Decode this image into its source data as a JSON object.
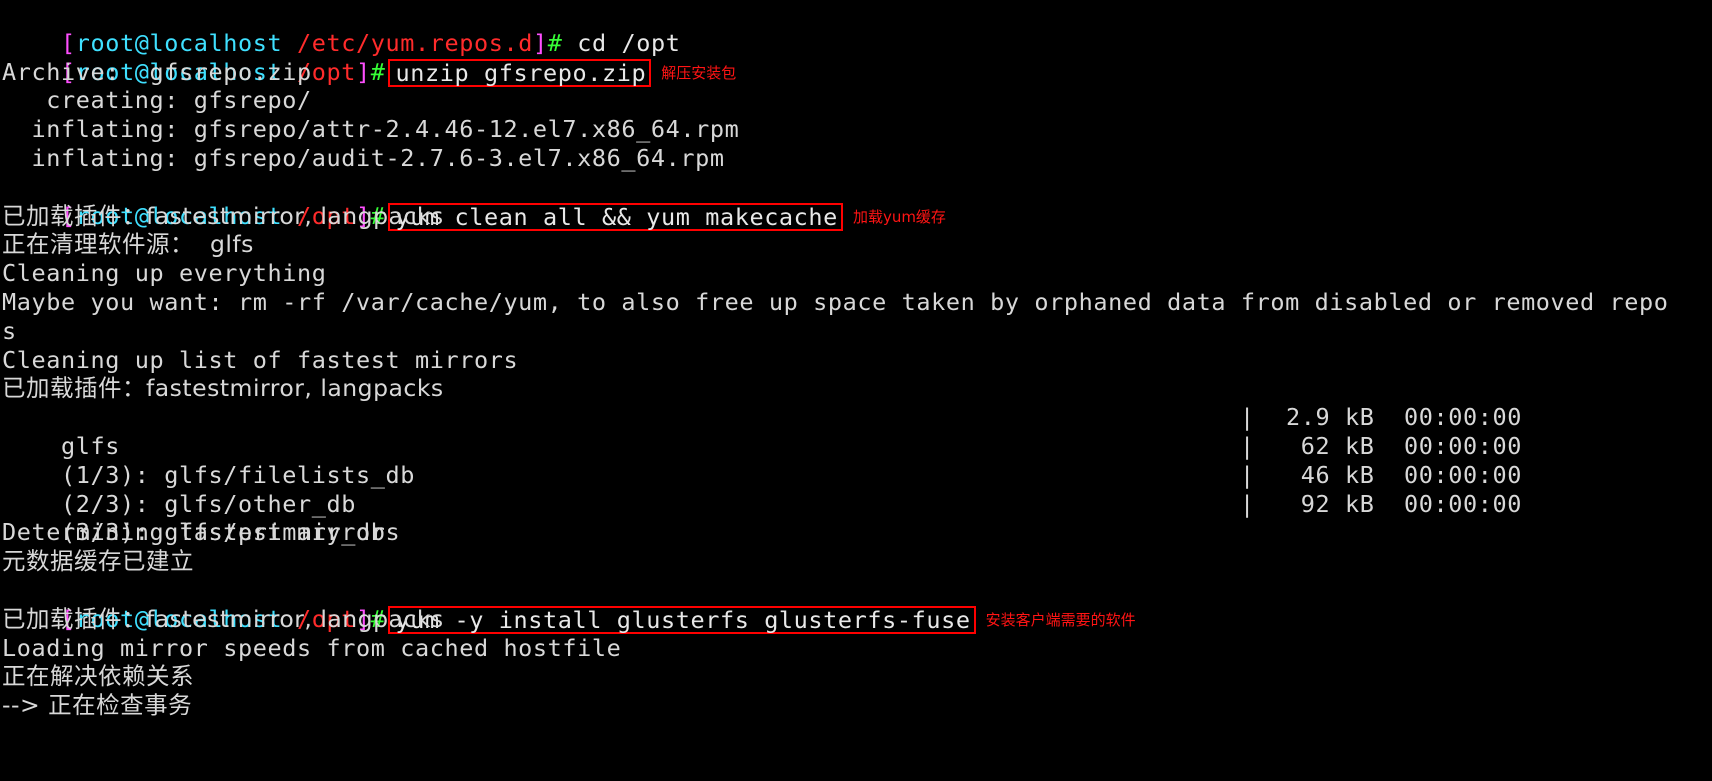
{
  "terminal": {
    "user": "root",
    "host": "localhost",
    "prompt_sep": "@",
    "hash": "#",
    "colors": {
      "background": "#000000",
      "foreground": "#d8d8d8",
      "bracket_magenta": "#ff4fff",
      "host_cyan": "#3fe0ff",
      "path_red": "#ff2b2b",
      "hash_green": "#36ff36",
      "annotation_red": "#ff1414",
      "box_border": "#ff0000"
    },
    "lines": [
      {
        "type": "prompt",
        "open_bracket": "[",
        "user_host": "root@localhost",
        "space": " ",
        "path": "/etc/yum.repos.d",
        "close_bracket": "]",
        "hash": "#",
        "command": " cd /opt",
        "boxed": false,
        "annotation": ""
      },
      {
        "type": "prompt",
        "open_bracket": "[",
        "user_host": "root@localhost",
        "space": " ",
        "path": "/opt",
        "close_bracket": "]",
        "hash": "#",
        "command": "unzip gfsrepo.zip",
        "boxed": true,
        "annotation": "解压安装包"
      },
      {
        "type": "out",
        "text": "Archive:  gfsrepo.zip"
      },
      {
        "type": "out",
        "text": "   creating: gfsrepo/"
      },
      {
        "type": "out",
        "text": "  inflating: gfsrepo/attr-2.4.46-12.el7.x86_64.rpm"
      },
      {
        "type": "out",
        "text": "  inflating: gfsrepo/audit-2.7.6-3.el7.x86_64.rpm"
      },
      {
        "type": "prompt",
        "open_bracket": "[",
        "user_host": "root@localhost",
        "space": " ",
        "path": "/opt",
        "close_bracket": "]",
        "hash": "#",
        "command": "yum clean all && yum makecache",
        "boxed": true,
        "annotation": "加载yum缓存"
      },
      {
        "type": "out-cjk",
        "text": "已加载插件：fastestmirror, langpacks"
      },
      {
        "type": "out-cjk",
        "text": "正在清理软件源：  glfs"
      },
      {
        "type": "out",
        "text": "Cleaning up everything"
      },
      {
        "type": "out",
        "text": "Maybe you want: rm -rf /var/cache/yum, to also free up space taken by orphaned data from disabled or removed repo"
      },
      {
        "type": "out",
        "text": "s"
      },
      {
        "type": "out",
        "text": "Cleaning up list of fastest mirrors"
      },
      {
        "type": "out-cjk",
        "text": "已加载插件：fastestmirror, langpacks"
      },
      {
        "type": "dl",
        "name": "glfs",
        "size": "2.9 kB",
        "time": "00:00:00"
      },
      {
        "type": "dl",
        "name": "(1/3): glfs/filelists_db",
        "size": "62 kB",
        "time": "00:00:00"
      },
      {
        "type": "dl",
        "name": "(2/3): glfs/other_db",
        "size": "46 kB",
        "time": "00:00:00"
      },
      {
        "type": "dl",
        "name": "(3/3): glfs/primary_db",
        "size": "92 kB",
        "time": "00:00:00"
      },
      {
        "type": "out",
        "text": "Determining fastest mirrors"
      },
      {
        "type": "out-cjk",
        "text": "元数据缓存已建立"
      },
      {
        "type": "prompt",
        "open_bracket": "[",
        "user_host": "root@localhost",
        "space": " ",
        "path": "/opt",
        "close_bracket": "]",
        "hash": "#",
        "command": "yum -y install glusterfs glusterfs-fuse",
        "boxed": true,
        "annotation": "安装客户端需要的软件"
      },
      {
        "type": "out-cjk",
        "text": "已加载插件：fastestmirror, langpacks"
      },
      {
        "type": "out",
        "text": "Loading mirror speeds from cached hostfile"
      },
      {
        "type": "out-cjk",
        "text": "正在解决依赖关系"
      },
      {
        "type": "out-cjk",
        "text": "--> 正在检查事务"
      }
    ]
  }
}
